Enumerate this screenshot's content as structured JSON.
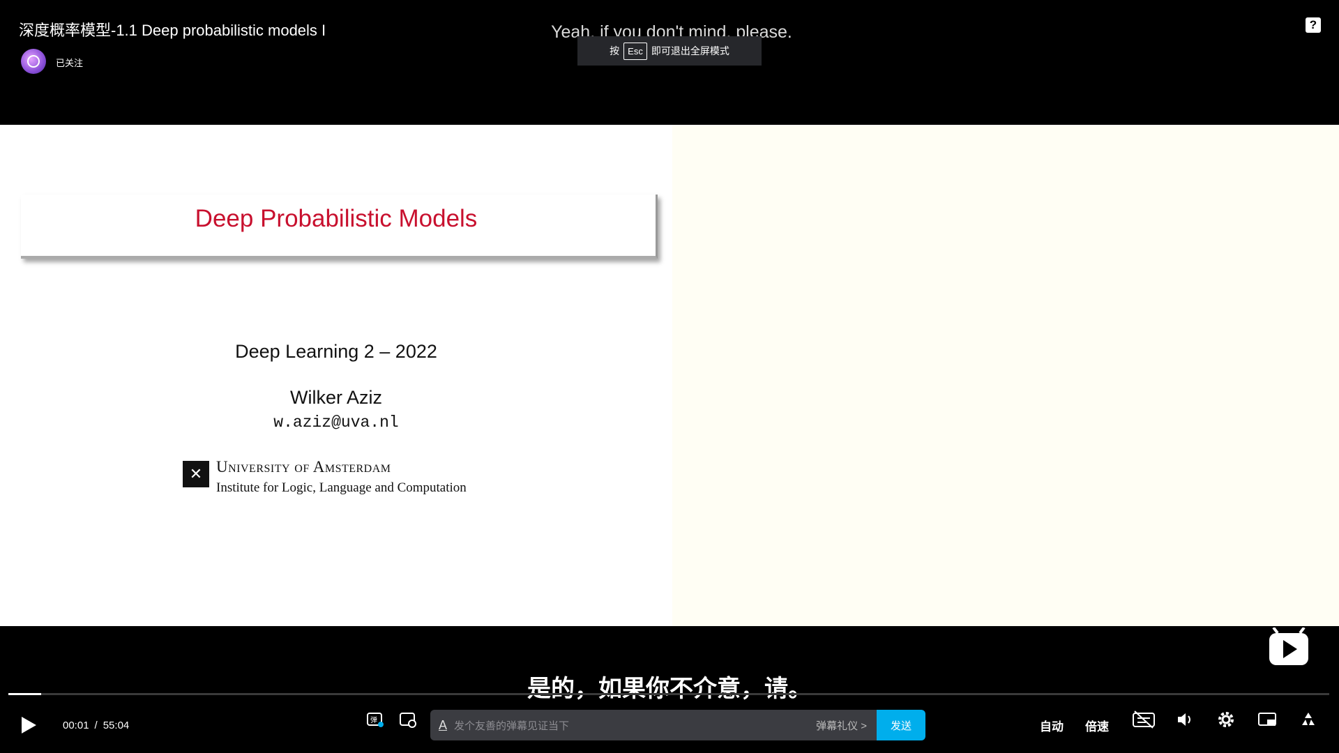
{
  "header": {
    "title": "深度概率模型-1.1 Deep probabilistic models I",
    "follow_status": "已关注",
    "help_icon": "question-mark-icon"
  },
  "overlay": {
    "english_subtitle": "Yeah, if you don't mind, please.",
    "esc_prefix": "按",
    "esc_key": "Esc",
    "esc_suffix": "即可退出全屏模式"
  },
  "slide": {
    "title": "Deep Probabilistic Models",
    "course": "Deep Learning 2 – 2022",
    "author": "Wilker Aziz",
    "email": "w.aziz@uva.nl",
    "university": "University of Amsterdam",
    "institute": "Institute for Logic, Language and Computation"
  },
  "subtitle": {
    "chinese": "是的，如果你不介意，请。"
  },
  "player": {
    "current_time": "00:01",
    "separator": "/",
    "duration": "55:04",
    "progress_fraction": 0.0003,
    "danmaku_placeholder": "发个友善的弹幕见证当下",
    "danmaku_etiquette": "弹幕礼仪 >",
    "send_label": "发送",
    "quality_label": "自动",
    "speed_label": "倍速",
    "accent_color": "#00aeec"
  }
}
